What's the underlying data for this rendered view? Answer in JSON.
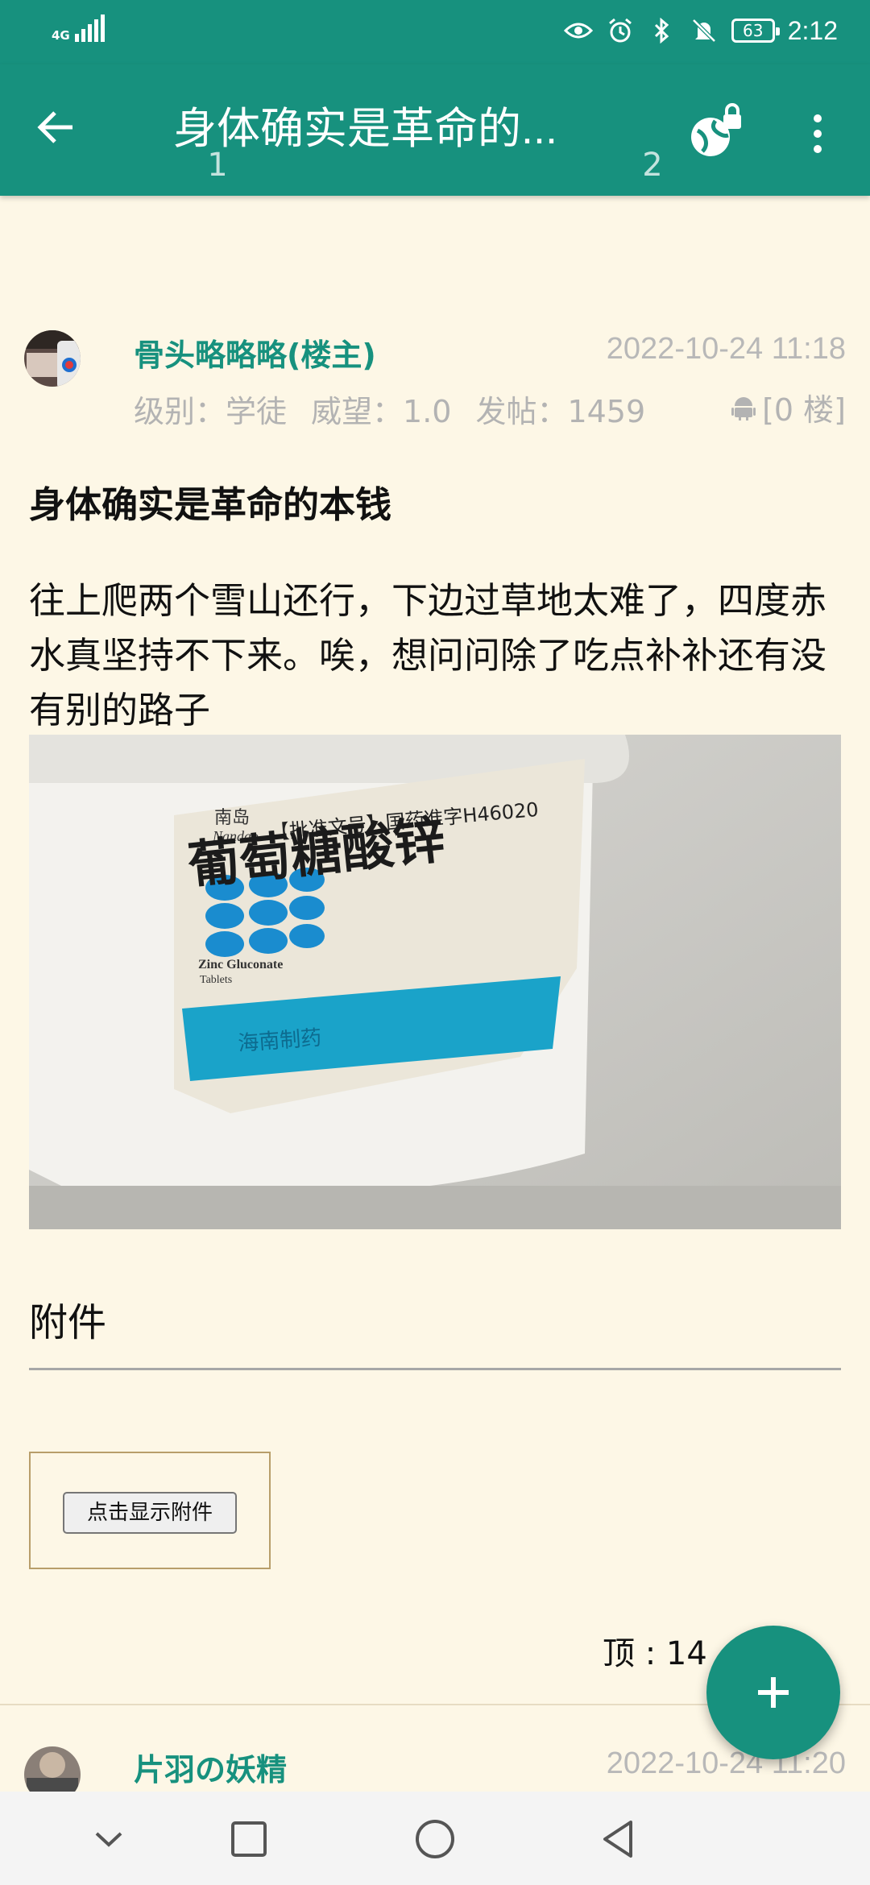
{
  "status_bar": {
    "network": "4G",
    "time": "2:12",
    "battery": "63",
    "icons": [
      "signal-icon",
      "eye-icon",
      "alarm-icon",
      "bluetooth-icon",
      "bell-mute-icon",
      "battery-icon"
    ]
  },
  "app_bar": {
    "title": "身体确实是革命的...",
    "tabs": [
      {
        "label": "1"
      },
      {
        "label": "2"
      }
    ],
    "icons": [
      "back-arrow-icon",
      "globe-lock-icon",
      "more-vert-icon"
    ]
  },
  "post": {
    "author": "骨头略略略(楼主)",
    "date": "2022-10-24 11:18",
    "level": "级别：学徒",
    "prestige": "威望：1.0",
    "posts": "发帖：1459",
    "floor": "[0 楼]",
    "device_icon": "android-icon",
    "title": "身体确实是革命的本钱",
    "body": "往上爬两个雪山还行，下边过草地太难了，四度赤水真坚持不下来。唉，想问问除了吃点补补还有没有别的路子",
    "photo": {
      "brand": "南岛",
      "brand_en": "Nandao",
      "approval": "【批准文号】国药准字H46020",
      "product": "葡萄糖酸锌",
      "en1": "Zinc Gluconate",
      "en2": "Tablets",
      "maker": "海南制药"
    },
    "attachment_label": "附件",
    "show_attachment_button": "点击显示附件",
    "like_label": "顶 : 14"
  },
  "reply": {
    "author": "片羽の妖精",
    "date": "2022-10-24 11:20"
  },
  "fab_icon": "plus-icon",
  "nav_bar": {
    "icons": [
      "nav-down-icon",
      "recents-icon",
      "home-icon",
      "back-icon"
    ]
  },
  "colors": {
    "primary": "#17917e",
    "background": "#fdf7e6"
  }
}
